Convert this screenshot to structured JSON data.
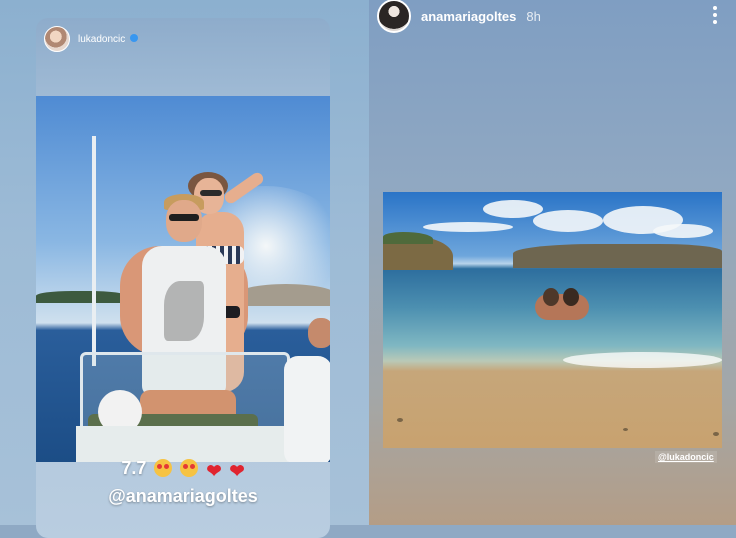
{
  "left_story": {
    "username": "lukadoncic",
    "verified": true,
    "caption_score": "7.7",
    "caption_emojis": [
      "heart-eyes-emoji",
      "heart-eyes-emoji",
      "red-heart-emoji",
      "red-heart-emoji"
    ],
    "caption_mention": "@anamariagoltes"
  },
  "right_story": {
    "username": "anamariagoltes",
    "time_ago": "8h",
    "mention_sticker": "@lukadoncic"
  },
  "icons": {
    "verified": "verified-badge-icon",
    "more": "more-vertical-icon"
  },
  "colors": {
    "verified_blue": "#3897f0",
    "heart_red": "#e0242f",
    "text_white": "#ffffff"
  }
}
